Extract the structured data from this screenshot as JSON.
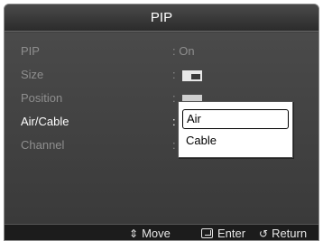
{
  "title": "PIP",
  "menu": [
    {
      "label": "PIP",
      "value": ": On"
    },
    {
      "label": "Size",
      "value": ":"
    },
    {
      "label": "Position",
      "value": ":"
    },
    {
      "label": "Air/Cable",
      "value": ":"
    },
    {
      "label": "Channel",
      "value": ":"
    }
  ],
  "dropdown": {
    "options": [
      "Air",
      "Cable"
    ],
    "selected": "Air"
  },
  "footer": {
    "move": "Move",
    "enter": "Enter",
    "return": "Return"
  },
  "icons": {
    "size": "size-icon",
    "position": "position-icon",
    "move": "up-down-arrow-icon",
    "enter": "enter-icon",
    "return": "return-icon"
  }
}
